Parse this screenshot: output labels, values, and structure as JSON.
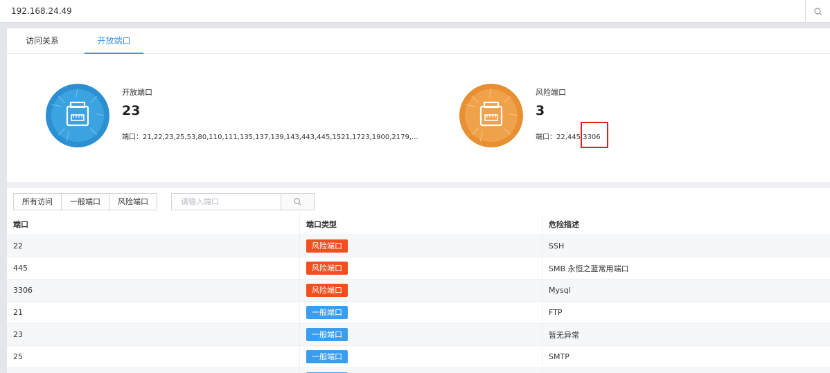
{
  "search_bar": {
    "value": "192.168.24.49"
  },
  "tabs": [
    {
      "label": "访问关系",
      "active": false
    },
    {
      "label": "开放端口",
      "active": true
    }
  ],
  "stats": {
    "open": {
      "label": "开放端口",
      "count": "23",
      "ports": "端口：21,22,23,25,53,80,110,111,135,137,139,143,443,445,1521,1723,1900,2179,..."
    },
    "risk": {
      "label": "风险端口",
      "count": "3",
      "ports": "端口：22,445,3306"
    }
  },
  "filters": {
    "buttons": [
      "所有访问",
      "一般端口",
      "风险端口"
    ],
    "search_placeholder": "请输入端口"
  },
  "table": {
    "headers": [
      "端口",
      "端口类型",
      "危险描述"
    ],
    "rows": [
      {
        "port": "22",
        "type": "风险端口",
        "kind": "risk",
        "desc": "SSH"
      },
      {
        "port": "445",
        "type": "风险端口",
        "kind": "risk",
        "desc": "SMB 永恒之蓝常用端口"
      },
      {
        "port": "3306",
        "type": "风险端口",
        "kind": "risk",
        "desc": "Mysql"
      },
      {
        "port": "21",
        "type": "一般端口",
        "kind": "normal",
        "desc": "FTP"
      },
      {
        "port": "23",
        "type": "一般端口",
        "kind": "normal",
        "desc": "暂无异常"
      },
      {
        "port": "25",
        "type": "一般端口",
        "kind": "normal",
        "desc": "SMTP"
      },
      {
        "port": "",
        "type": "一般端口",
        "kind": "normal",
        "desc": ""
      }
    ]
  },
  "colors": {
    "accent": "#3a95e6",
    "risk": "#f24e1e",
    "normal": "#3b9df0",
    "open_ring": "#2b8fd1",
    "risk_ring": "#e88f32"
  }
}
